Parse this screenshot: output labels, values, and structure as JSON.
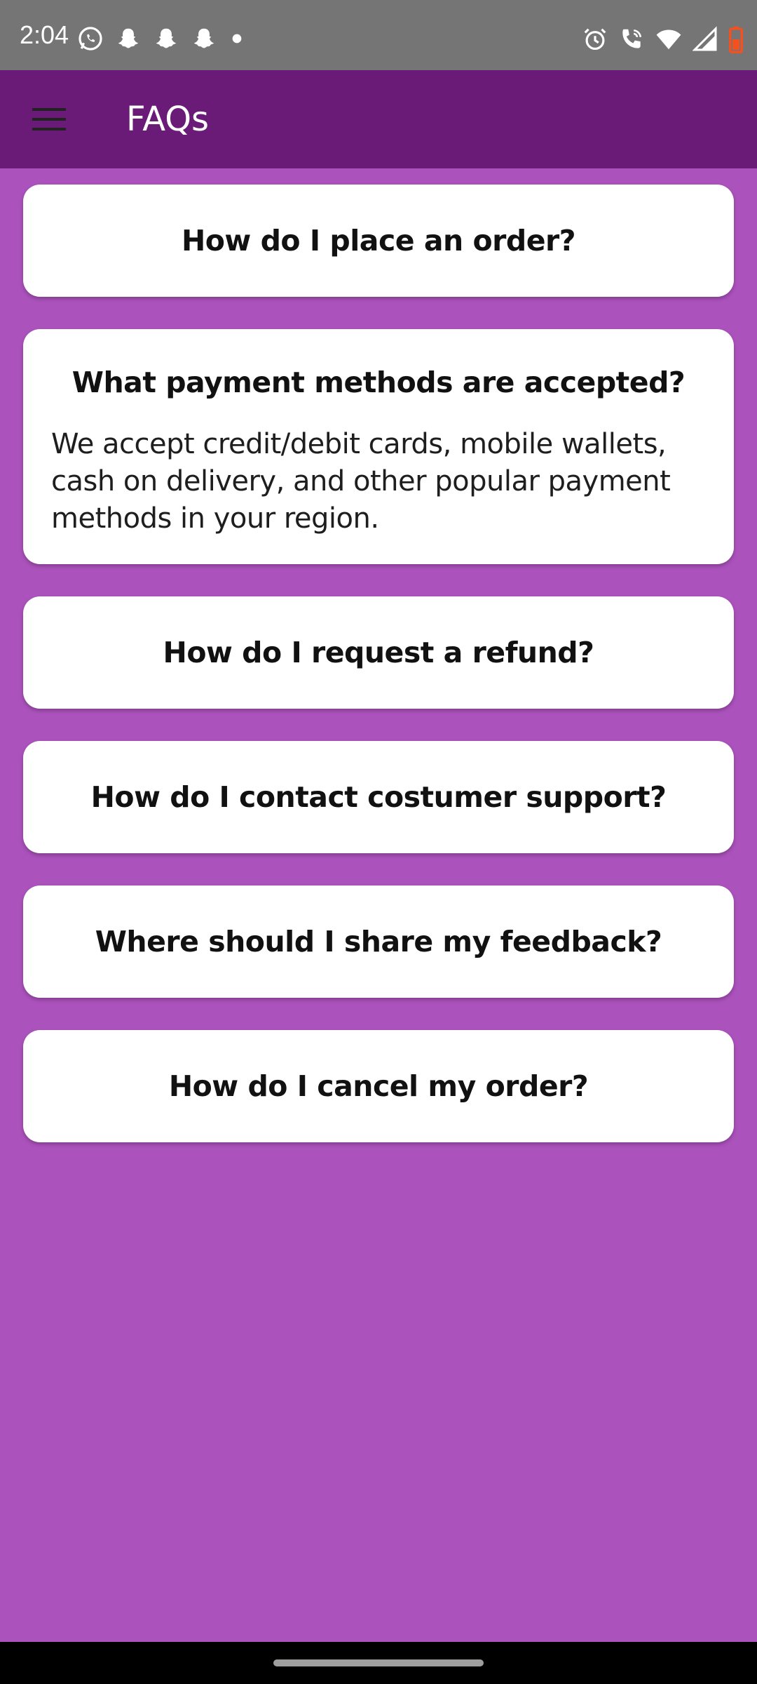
{
  "status_bar": {
    "time": "2:04",
    "left_icons": [
      "whatsapp-icon",
      "snapchat-icon",
      "snapchat-icon",
      "snapchat-icon",
      "dot-icon"
    ],
    "right_icons": [
      "alarm-icon",
      "wifi-calling-icon",
      "wifi-icon",
      "signal-icon",
      "battery-icon"
    ]
  },
  "app_bar": {
    "title": "FAQs",
    "menu_icon": "hamburger-menu-icon"
  },
  "faqs": [
    {
      "question": "How do I place an order?",
      "expanded": false
    },
    {
      "question": "What payment methods are accepted?",
      "expanded": true,
      "answer": "We accept credit/debit cards, mobile wallets, cash on delivery, and other popular payment methods in your region."
    },
    {
      "question": "How do I request a refund?",
      "expanded": false
    },
    {
      "question": "How do I contact costumer support?",
      "expanded": false
    },
    {
      "question": "Where should I share my feedback?",
      "expanded": false
    },
    {
      "question": "How do I cancel my order?",
      "expanded": false
    }
  ],
  "colors": {
    "background": "#ac52bd",
    "app_bar": "#6a1b78",
    "status_bar": "#757575",
    "card": "#ffffff",
    "battery_accent": "#f4511e"
  }
}
